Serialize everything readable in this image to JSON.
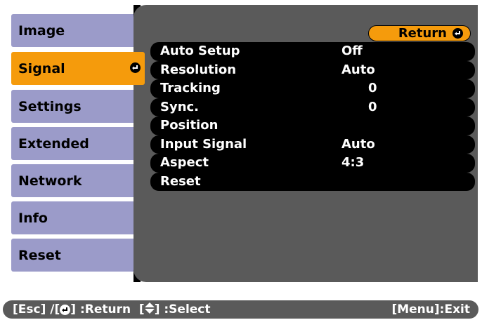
{
  "sidebar": {
    "items": [
      {
        "label": "Image"
      },
      {
        "label": "Signal",
        "active": true
      },
      {
        "label": "Settings"
      },
      {
        "label": "Extended"
      },
      {
        "label": "Network"
      },
      {
        "label": "Info"
      },
      {
        "label": "Reset"
      }
    ]
  },
  "panel": {
    "return_label": "Return",
    "rows": [
      {
        "label": "Auto Setup",
        "value": "Off"
      },
      {
        "label": "Resolution",
        "value": "Auto"
      },
      {
        "label": "Tracking",
        "value": "0"
      },
      {
        "label": "Sync.",
        "value": "0"
      },
      {
        "label": "Position",
        "value": ""
      },
      {
        "label": "Input Signal",
        "value": "Auto"
      },
      {
        "label": "Aspect",
        "value": "4:3"
      },
      {
        "label": "Reset",
        "value": ""
      }
    ]
  },
  "footer": {
    "esc_part": "[Esc] /[",
    "return_part": "] :Return  [",
    "select_part": "] :Select",
    "exit_label": "[Menu]:Exit"
  },
  "colors": {
    "accent": "#f59b0c",
    "tab": "#9b9bc9",
    "panel": "#5a5a5a"
  },
  "icons": {
    "enter": "enter-icon",
    "updown": "up-down-arrows-icon"
  }
}
